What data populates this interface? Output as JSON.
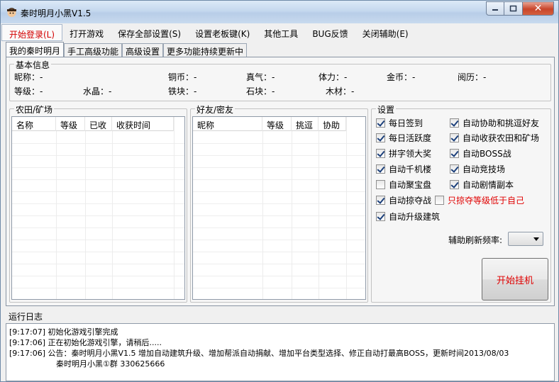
{
  "window": {
    "title": "秦时明月小黑V1.5",
    "icon": "app-character-icon"
  },
  "menu": [
    {
      "label": "开始登录(L)"
    },
    {
      "label": "打开游戏"
    },
    {
      "label": "保存全部设置(S)"
    },
    {
      "label": "设置老板键(K)"
    },
    {
      "label": "其他工具"
    },
    {
      "label": "BUG反馈"
    },
    {
      "label": "关闭辅助(E)"
    }
  ],
  "tabs": [
    {
      "label": "我的秦时明月"
    },
    {
      "label": "手工高级功能"
    },
    {
      "label": "高级设置"
    },
    {
      "label": "更多功能持续更新中"
    }
  ],
  "basic_info": {
    "title": "基本信息",
    "row1": [
      {
        "label": "昵称：",
        "value": "-"
      },
      {
        "label": "铜币：",
        "value": "-"
      },
      {
        "label": "真气：",
        "value": "-"
      },
      {
        "label": "体力：",
        "value": "-"
      },
      {
        "label": "金币：",
        "value": "-"
      },
      {
        "label": "阅历：",
        "value": "-"
      }
    ],
    "row2": [
      {
        "label": "等级：",
        "value": "-"
      },
      {
        "label": "水晶：",
        "value": "-"
      },
      {
        "label": "铁块：",
        "value": "-"
      },
      {
        "label": "石块：",
        "value": "-"
      },
      {
        "label": "木材：",
        "value": "-"
      }
    ]
  },
  "farm": {
    "title": "农田/矿场",
    "columns": [
      "名称",
      "等级",
      "已收",
      "收获时间"
    ]
  },
  "friends": {
    "title": "好友/密友",
    "columns": [
      "昵称",
      "等级",
      "挑逗",
      "协助"
    ]
  },
  "settings": {
    "title": "设置",
    "left": [
      {
        "label": "每日签到",
        "checked": true
      },
      {
        "label": "每日活跃度",
        "checked": true
      },
      {
        "label": "拼字领大奖",
        "checked": true
      },
      {
        "label": "自动千机楼",
        "checked": true
      },
      {
        "label": "自动聚宝盘",
        "checked": false
      },
      {
        "label": "自动掠夺战",
        "checked": true
      },
      {
        "label": "自动升级建筑",
        "checked": true
      }
    ],
    "right": [
      {
        "label": "自动协助和挑逗好友",
        "checked": true
      },
      {
        "label": "自动收获农田和矿场",
        "checked": true
      },
      {
        "label": "自动BOSS战",
        "checked": true
      },
      {
        "label": "自动竞技场",
        "checked": true
      },
      {
        "label": "自动剧情副本",
        "checked": true
      }
    ],
    "plunder_low_level": {
      "label": "只掠夺等级低于自己",
      "checked": false
    },
    "refresh_label": "辅助刷新频率:",
    "refresh_value": "",
    "start_label": "开始挂机"
  },
  "log": {
    "title": "运行日志",
    "lines": [
      "[9:17:07] 初始化游戏引擎完成",
      "[9:17:06] 正在初始化游戏引擎，请稍后.....",
      "[9:17:06] 公告：秦时明月小黑V1.5 增加自动建筑升级、增加帮派自动捐献、增加平台类型选择、修正自动打最高BOSS，更新时间2013/08/03",
      "秦时明月小黑①群  330625666"
    ]
  }
}
